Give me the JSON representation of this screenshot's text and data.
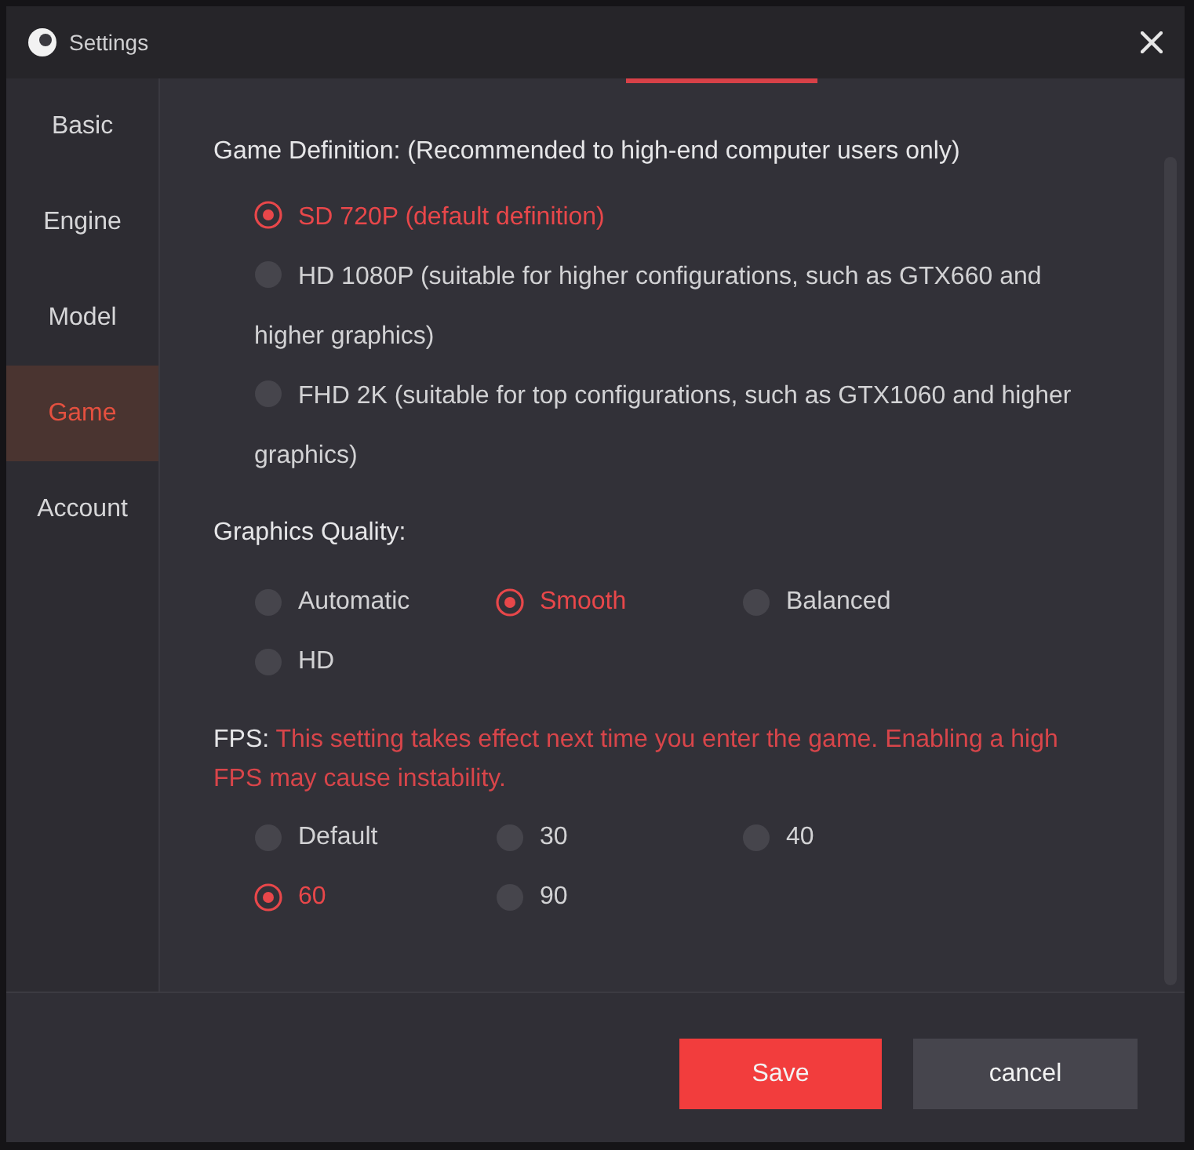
{
  "window": {
    "title": "Settings"
  },
  "sidebar": {
    "items": [
      {
        "label": "Basic",
        "selected": false
      },
      {
        "label": "Engine",
        "selected": false
      },
      {
        "label": "Model",
        "selected": false
      },
      {
        "label": "Game",
        "selected": true
      },
      {
        "label": "Account",
        "selected": false
      }
    ]
  },
  "game_definition": {
    "label": "Game Definition: (Recommended to high-end computer users only)",
    "options": [
      {
        "label": "SD 720P (default definition)",
        "selected": true
      },
      {
        "label": "HD 1080P (suitable for higher configurations, such as GTX660 and higher graphics)",
        "selected": false
      },
      {
        "label": "FHD 2K (suitable for top configurations, such as GTX1060 and higher graphics)",
        "selected": false
      }
    ]
  },
  "graphics_quality": {
    "label": "Graphics Quality:",
    "options": [
      {
        "label": "Automatic",
        "selected": false
      },
      {
        "label": "Smooth",
        "selected": true
      },
      {
        "label": "Balanced",
        "selected": false
      },
      {
        "label": "HD",
        "selected": false
      }
    ]
  },
  "fps": {
    "label": "FPS:",
    "note": "This setting takes effect next time you enter the game. Enabling a high FPS may cause instability.",
    "options": [
      {
        "label": "Default",
        "selected": false
      },
      {
        "label": "30",
        "selected": false
      },
      {
        "label": "40",
        "selected": false
      },
      {
        "label": "60",
        "selected": true
      },
      {
        "label": "90",
        "selected": false
      }
    ]
  },
  "buttons": [
    {
      "label": "Save",
      "kind": "primary"
    },
    {
      "label": "cancel",
      "kind": "secondary"
    }
  ]
}
